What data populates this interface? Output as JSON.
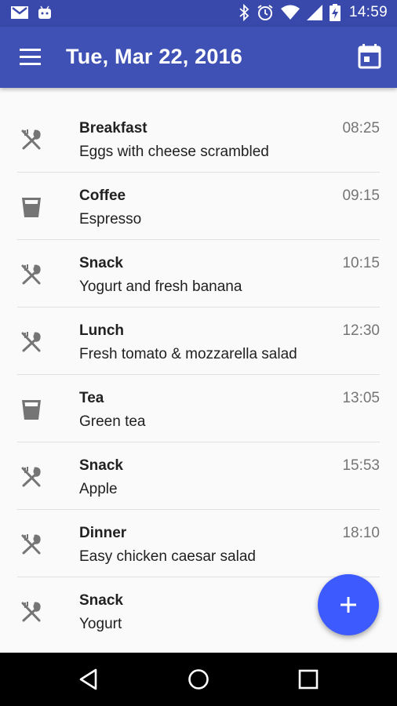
{
  "status_bar": {
    "time": "14:59",
    "left_icons": [
      "gmail-icon",
      "android-icon"
    ],
    "right_icons": [
      "bluetooth-icon",
      "alarm-icon",
      "wifi-icon",
      "signal-icon",
      "battery-charging-icon"
    ]
  },
  "app_bar": {
    "title": "Tue, Mar 22, 2016",
    "menu_icon": "menu-icon",
    "action_icon": "calendar-icon",
    "color": "#3f51b5"
  },
  "entries": [
    {
      "type": "food",
      "name": "Breakfast",
      "description": "Eggs with cheese scrambled",
      "time": "08:25"
    },
    {
      "type": "drink",
      "name": "Coffee",
      "description": "Espresso",
      "time": "09:15"
    },
    {
      "type": "food",
      "name": "Snack",
      "description": "Yogurt and fresh banana",
      "time": "10:15"
    },
    {
      "type": "food",
      "name": "Lunch",
      "description": "Fresh tomato & mozzarella salad",
      "time": "12:30"
    },
    {
      "type": "drink",
      "name": "Tea",
      "description": "Green tea",
      "time": "13:05"
    },
    {
      "type": "food",
      "name": "Snack",
      "description": "Apple",
      "time": "15:53"
    },
    {
      "type": "food",
      "name": "Dinner",
      "description": "Easy chicken caesar salad",
      "time": "18:10"
    },
    {
      "type": "food",
      "name": "Snack",
      "description": "Yogurt",
      "time": ""
    }
  ],
  "fab": {
    "icon": "add-icon",
    "color": "#3d5afe"
  },
  "nav_bar": {
    "buttons": [
      "back-icon",
      "home-icon",
      "recents-icon"
    ]
  }
}
